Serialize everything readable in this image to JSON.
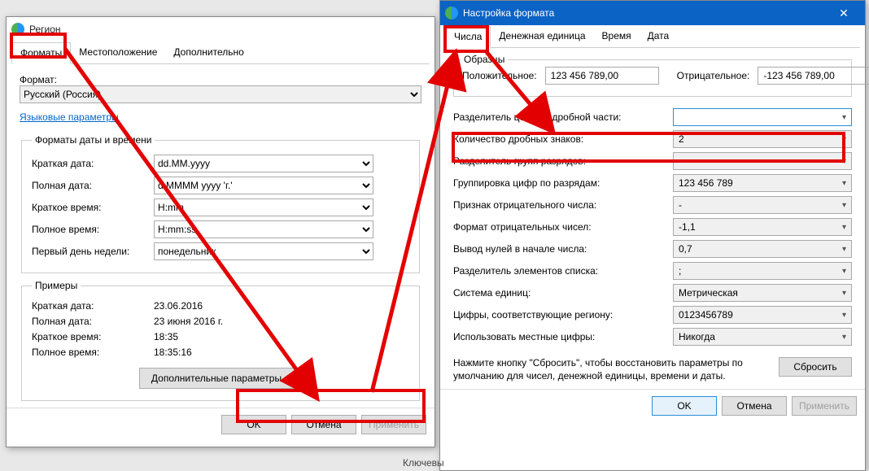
{
  "left": {
    "title": "Регион",
    "tabs": [
      "Форматы",
      "Местоположение",
      "Дополнительно"
    ],
    "format_label": "Формат:",
    "format_value": "Русский (Россия)",
    "lang_link": "Языковые параметры",
    "dt_legend": "Форматы даты и времени",
    "rows": [
      {
        "lbl": "Краткая дата:",
        "val": "dd.MM.yyyy"
      },
      {
        "lbl": "Полная дата:",
        "val": "d MMMM yyyy 'г.'"
      },
      {
        "lbl": "Краткое время:",
        "val": "H:mm"
      },
      {
        "lbl": "Полное время:",
        "val": "H:mm:ss"
      },
      {
        "lbl": "Первый день недели:",
        "val": "понедельник"
      }
    ],
    "ex_legend": "Примеры",
    "examples": [
      {
        "lbl": "Краткая дата:",
        "val": "23.06.2016"
      },
      {
        "lbl": "Полная дата:",
        "val": "23 июня 2016 г."
      },
      {
        "lbl": "Краткое время:",
        "val": "18:35"
      },
      {
        "lbl": "Полное время:",
        "val": "18:35:16"
      }
    ],
    "additional_btn": "Дополнительные параметры...",
    "ok": "OK",
    "cancel": "Отмена",
    "apply": "Применить"
  },
  "right": {
    "title": "Настройка формата",
    "tabs": [
      "Числа",
      "Денежная единица",
      "Время",
      "Дата"
    ],
    "samples_title": "Образцы",
    "pos_lbl": "Положительное:",
    "pos_val": "123 456 789,00",
    "neg_lbl": "Отрицательное:",
    "neg_val": "-123 456 789,00",
    "rows": [
      {
        "lbl": "Разделитель целой и дробной части:",
        "val": ""
      },
      {
        "lbl": "Количество дробных знаков:",
        "val": "2"
      },
      {
        "lbl": "Разделитель групп разрядов:",
        "val": ""
      },
      {
        "lbl": "Группировка цифр по разрядам:",
        "val": "123 456 789"
      },
      {
        "lbl": "Признак отрицательного числа:",
        "val": "-"
      },
      {
        "lbl": "Формат отрицательных чисел:",
        "val": "-1,1"
      },
      {
        "lbl": "Вывод нулей в начале числа:",
        "val": "0,7"
      },
      {
        "lbl": "Разделитель элементов списка:",
        "val": ";"
      },
      {
        "lbl": "Система единиц:",
        "val": "Метрическая"
      },
      {
        "lbl": "Цифры, соответствующие региону:",
        "val": "0123456789"
      },
      {
        "lbl": "Использовать местные цифры:",
        "val": "Никогда"
      }
    ],
    "reset_text": "Нажмите кнопку \"Сбросить\", чтобы восстановить параметры по умолчанию для чисел, денежной единицы, времени и даты.",
    "reset_btn": "Сбросить",
    "ok": "OK",
    "cancel": "Отмена",
    "apply": "Применить"
  },
  "footer_stub": "Ключевы"
}
